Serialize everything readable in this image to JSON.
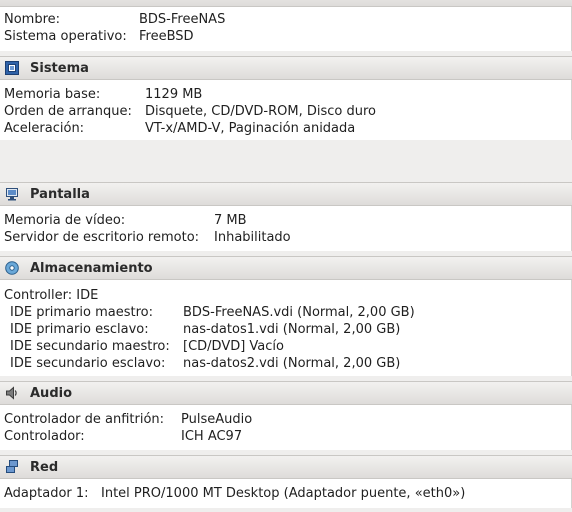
{
  "general": {
    "rows": [
      {
        "label": "Nombre:",
        "value": "BDS-FreeNAS"
      },
      {
        "label": "Sistema operativo:",
        "value": "FreeBSD"
      }
    ]
  },
  "system": {
    "title": "Sistema",
    "icon": "chip-icon",
    "rows": [
      {
        "label": "Memoria base:",
        "value": "1129 MB"
      },
      {
        "label": "Orden de arranque:",
        "value": "Disquete, CD/DVD-ROM, Disco duro"
      },
      {
        "label": "Aceleración:",
        "value": "VT-x/AMD-V, Paginación anidada"
      }
    ]
  },
  "display": {
    "title": "Pantalla",
    "icon": "monitor-icon",
    "rows": [
      {
        "label": "Memoria de vídeo:",
        "value": "7 MB"
      },
      {
        "label": "Servidor de escritorio remoto:",
        "value": "Inhabilitado"
      }
    ]
  },
  "storage": {
    "title": "Almacenamiento",
    "icon": "disk-icon",
    "controller": "Controller: IDE",
    "rows": [
      {
        "label": "IDE primario maestro:",
        "value": "BDS-FreeNAS.vdi (Normal, 2,00 GB)"
      },
      {
        "label": "IDE primario esclavo:",
        "value": "nas-datos1.vdi (Normal, 2,00 GB)"
      },
      {
        "label": "IDE secundario maestro:",
        "value": "[CD/DVD] Vacío"
      },
      {
        "label": "IDE secundario esclavo:",
        "value": "nas-datos2.vdi (Normal, 2,00 GB)"
      }
    ]
  },
  "audio": {
    "title": "Audio",
    "icon": "speaker-icon",
    "rows": [
      {
        "label": "Controlador de anfitrión:",
        "value": "PulseAudio"
      },
      {
        "label": "Controlador:",
        "value": "ICH AC97"
      }
    ]
  },
  "network": {
    "title": "Red",
    "icon": "network-icon",
    "rows": [
      {
        "label": "Adaptador 1:",
        "value": "Intel PRO/1000 MT Desktop (Adaptador puente, «eth0»)"
      }
    ]
  }
}
